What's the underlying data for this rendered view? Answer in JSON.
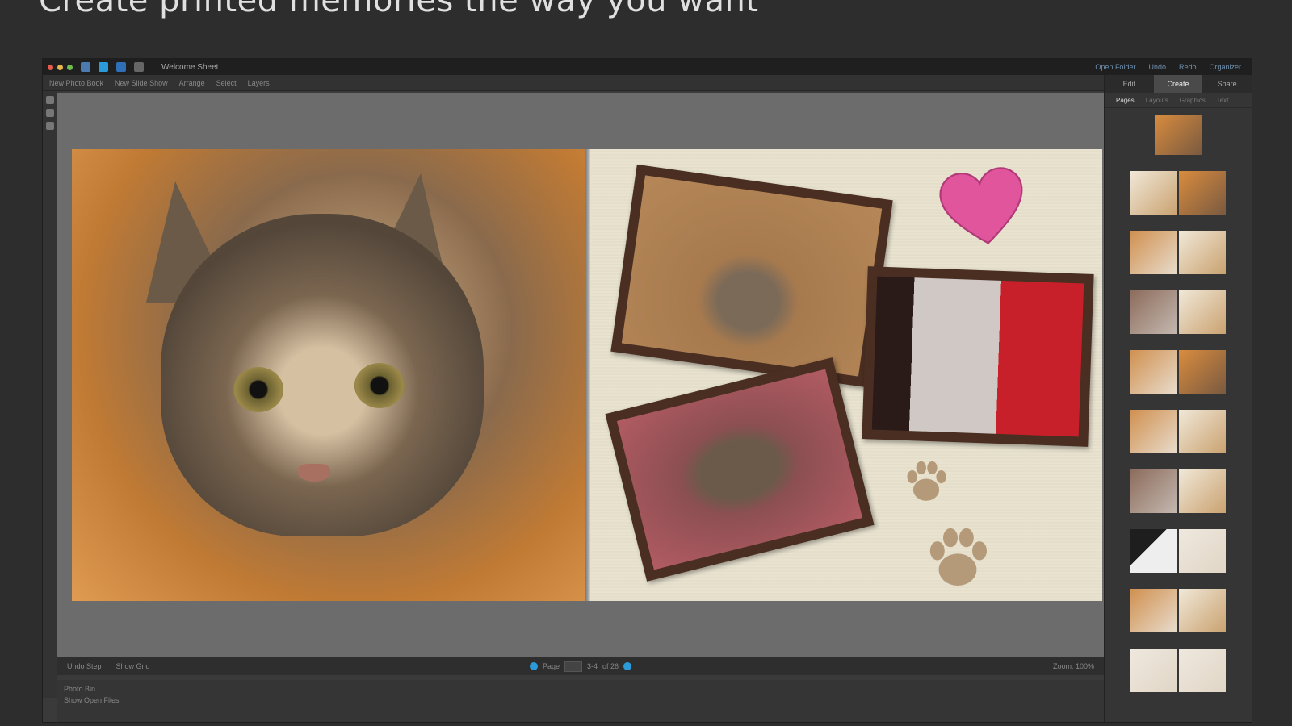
{
  "headline": "Create printed memories the way you want",
  "window": {
    "title": "Welcome Sheet"
  },
  "titlebar_actions": [
    "Open Folder",
    "Undo",
    "Redo",
    "Organizer"
  ],
  "toolbar_items": [
    "New Photo Book",
    "New Slide Show",
    "Arrange",
    "Select",
    "Layers"
  ],
  "mode_tabs": [
    "Edit",
    "Create",
    "Share"
  ],
  "active_mode": "Create",
  "sub_tabs": [
    "Pages",
    "Layouts",
    "Graphics",
    "Text"
  ],
  "bottom": {
    "left_buttons": [
      "Undo Step",
      "Show Grid"
    ],
    "page_label": "Page",
    "page_value": "3-4",
    "page_total": "of 26",
    "zoom_label": "Zoom: 100%"
  },
  "status": {
    "section_label": "Photo Bin",
    "line": "Show Open Files"
  },
  "colors": {
    "accent": "#2a9bd8",
    "heart": "#e0559b",
    "paw": "#b59a7a",
    "frame": "#4a2e22"
  }
}
